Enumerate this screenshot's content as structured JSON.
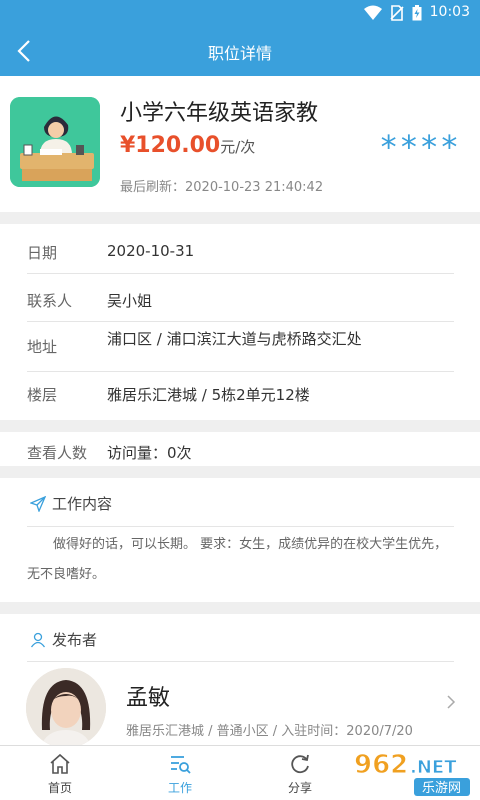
{
  "status": {
    "time": "10:03",
    "icons": [
      "wifi-icon",
      "no-sim-icon",
      "battery-icon"
    ]
  },
  "header": {
    "title": "职位详情",
    "back_icon": "back-arrow-icon"
  },
  "job": {
    "title": "小学六年级英语家教",
    "price": "¥120.00",
    "price_unit": "元/次",
    "rating": "****",
    "refresh_label": "最后刷新：",
    "refresh_time": "2020-10-23 21:40:42"
  },
  "info": {
    "rows": [
      {
        "label": "日期",
        "value": "2020-10-31"
      },
      {
        "label": "联系人",
        "value": "吴小姐"
      },
      {
        "label": "地址",
        "value": "浦口区 / 浦口滨江大道与虎桥路交汇处"
      },
      {
        "label": "楼层",
        "value": "雅居乐汇港城 / 5栋2单元12楼"
      }
    ]
  },
  "views": {
    "label": "查看人数",
    "value": "访问量：0次"
  },
  "work": {
    "heading": "工作内容",
    "text": "做得好的话，可以长期。 要求：女生，成绩优异的在校大学生优先，无不良嗜好。"
  },
  "publisher": {
    "heading": "发布者",
    "name": "孟敏",
    "meta": "雅居乐汇港城 / 普通小区 / 入驻时间：2020/7/20"
  },
  "tabs": [
    {
      "label": "首页",
      "icon": "home-icon",
      "active": false
    },
    {
      "label": "工作",
      "icon": "work-list-icon",
      "active": true
    },
    {
      "label": "分享",
      "icon": "share-icon",
      "active": false
    }
  ],
  "watermark": {
    "text": "962.NET",
    "subtext": "乐游网"
  },
  "colors": {
    "primary": "#3aa0dc",
    "price": "#e8502b",
    "thumb_bg": "#3fc79b"
  }
}
